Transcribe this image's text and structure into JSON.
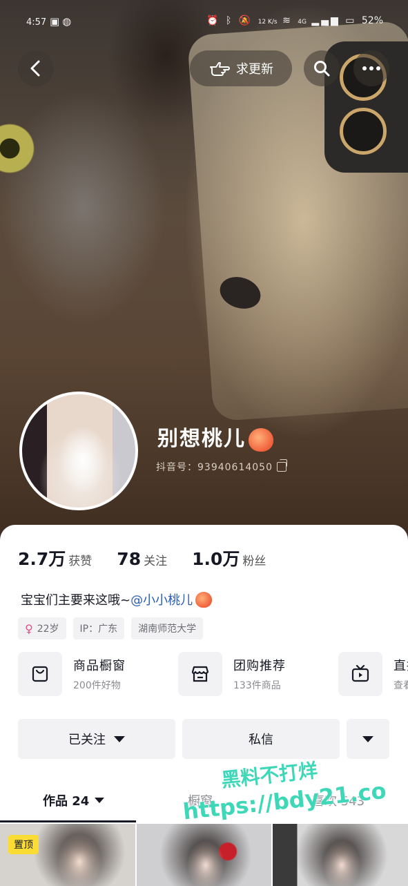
{
  "status_bar": {
    "time": "4:57",
    "network_speed": "12 K/s",
    "network_type": "4G",
    "battery": "52%"
  },
  "header": {
    "update_label": "求更新"
  },
  "profile": {
    "nickname": "别想桃儿",
    "douyin_id": "抖音号：93940614050"
  },
  "stats": {
    "likes_value": "2.7万",
    "likes_label": "获赞",
    "following_value": "78",
    "following_label": "关注",
    "followers_value": "1.0万",
    "followers_label": "粉丝"
  },
  "bio": {
    "text": "宝宝们主要来这哦~",
    "mention": "@小小桃儿"
  },
  "tags": {
    "age": "22岁",
    "ip": "IP：广东",
    "school": "湖南师范大学"
  },
  "services": [
    {
      "title": "商品橱窗",
      "subtitle": "200件好物",
      "icon": "bag-icon"
    },
    {
      "title": "团购推荐",
      "subtitle": "133件商品",
      "icon": "shop-icon"
    },
    {
      "title": "直播",
      "subtitle": "查看",
      "icon": "tv-icon"
    }
  ],
  "actions": {
    "followed_label": "已关注",
    "message_label": "私信"
  },
  "tabs": {
    "works_label": "作品 24",
    "showcase_label": "橱窗",
    "likes_label": "喜欢 543"
  },
  "grid": {
    "pinned_label": "置顶"
  },
  "watermark": {
    "line1": "黑料不打烊",
    "line2": "https://bdy21.co"
  },
  "colors": {
    "accent_yellow": "#fadc34",
    "mention_blue": "#2b5cb3",
    "watermark": "#3ed8b8"
  }
}
